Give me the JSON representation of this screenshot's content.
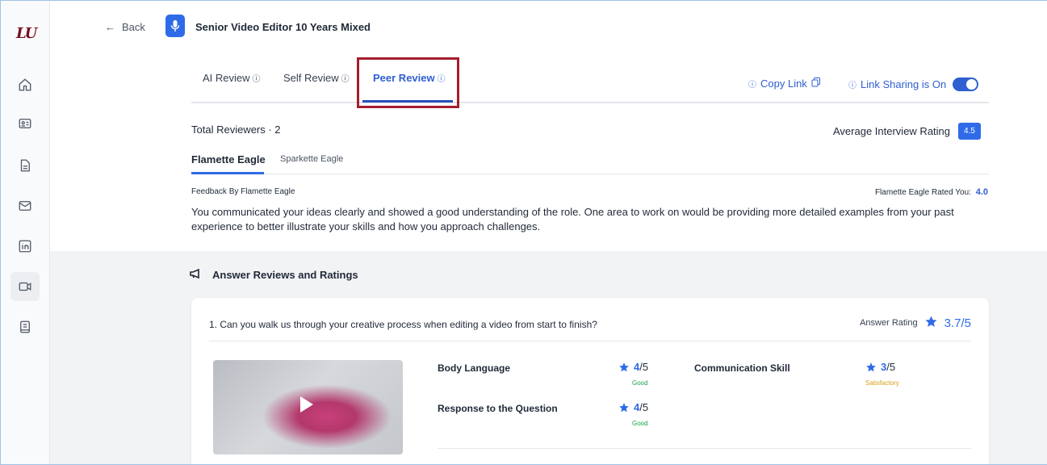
{
  "app": {
    "logo_text": "LU"
  },
  "sidebar": {
    "items": [
      {
        "name": "home-icon"
      },
      {
        "name": "id-card-icon"
      },
      {
        "name": "document-icon"
      },
      {
        "name": "mail-icon"
      },
      {
        "name": "linkedin-icon"
      },
      {
        "name": "video-icon",
        "active": true
      },
      {
        "name": "book-icon"
      }
    ]
  },
  "topbar": {
    "back_label": "Back",
    "title": "Senior Video Editor 10 Years Mixed"
  },
  "tabs": [
    {
      "label": "AI Review"
    },
    {
      "label": "Self Review"
    },
    {
      "label": "Peer Review",
      "active": true
    }
  ],
  "actions": {
    "copy_link": "Copy Link",
    "link_sharing": "Link Sharing is On",
    "link_sharing_on": true
  },
  "summary": {
    "total_reviewers": "Total Reviewers · 2",
    "average_label": "Average Interview Rating",
    "average_value": "4.5"
  },
  "reviewer_tabs": [
    {
      "label": "Flamette Eagle",
      "active": true
    },
    {
      "label": "Sparkette Eagle"
    }
  ],
  "feedback": {
    "by": "Feedback By Flamette Eagle",
    "rated_label": "Flamette Eagle Rated You:",
    "rated_value": "4.0",
    "text": "You communicated your ideas clearly and showed a good understanding of the role. One area to work on would be providing more detailed examples from your past experience to better illustrate your skills and how you approach challenges."
  },
  "answers": {
    "heading": "Answer Reviews and Ratings",
    "items": [
      {
        "question": "1. Can you walk us through your creative process when editing a video from start to finish?",
        "rating_label": "Answer Rating",
        "rating_value": "3.7/5",
        "metrics": [
          {
            "label": "Body Language",
            "score": "4",
            "out_of": "/5",
            "verdict": "Good"
          },
          {
            "label": "Communication Skill",
            "score": "3",
            "out_of": "/5",
            "verdict": "Satisfactory"
          },
          {
            "label": "Response to the Question",
            "score": "4",
            "out_of": "/5",
            "verdict": "Good"
          }
        ]
      }
    ]
  },
  "colors": {
    "accent": "#2f6be8",
    "highlight_box": "#a31e2e",
    "good": "#16a34a",
    "satisfactory": "#d4a017"
  }
}
